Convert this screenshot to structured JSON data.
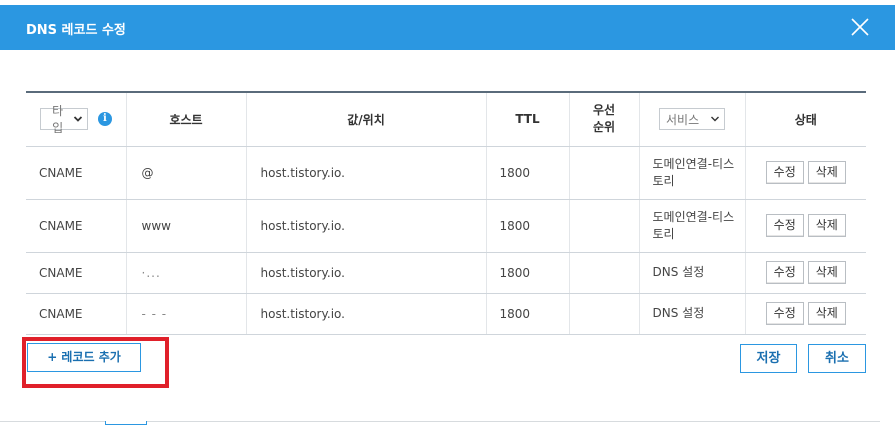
{
  "dialog": {
    "title": "DNS 레코드 수정"
  },
  "table": {
    "headers": {
      "type_select": "타입",
      "host": "호스트",
      "value": "값/위치",
      "ttl": "TTL",
      "priority": "우선\n순위",
      "service_select": "서비스",
      "state": "상태"
    },
    "rows": [
      {
        "type": "CNAME",
        "host": "@",
        "value": "host.tistory.io.",
        "ttl": "1800",
        "service": "도메인연결-티스토리",
        "edit": "수정",
        "delete": "삭제"
      },
      {
        "type": "CNAME",
        "host": "www",
        "value": "host.tistory.io.",
        "ttl": "1800",
        "service": "도메인연결-티스토리",
        "edit": "수정",
        "delete": "삭제"
      },
      {
        "type": "CNAME",
        "host": "·...",
        "value": "host.tistory.io.",
        "ttl": "1800",
        "service": "DNS 설정",
        "edit": "수정",
        "delete": "삭제"
      },
      {
        "type": "CNAME",
        "host": "- - -",
        "value": "host.tistory.io.",
        "ttl": "1800",
        "service": "DNS 설정",
        "edit": "수정",
        "delete": "삭제"
      }
    ]
  },
  "actions": {
    "add_record": "+ 레코드 추가",
    "save": "저장",
    "cancel": "취소"
  },
  "icons": {
    "close": "close-icon",
    "info": "info-icon",
    "chevron": "chevron-down-icon"
  },
  "colors": {
    "accent": "#2b97e1",
    "highlight": "#e0202a"
  }
}
